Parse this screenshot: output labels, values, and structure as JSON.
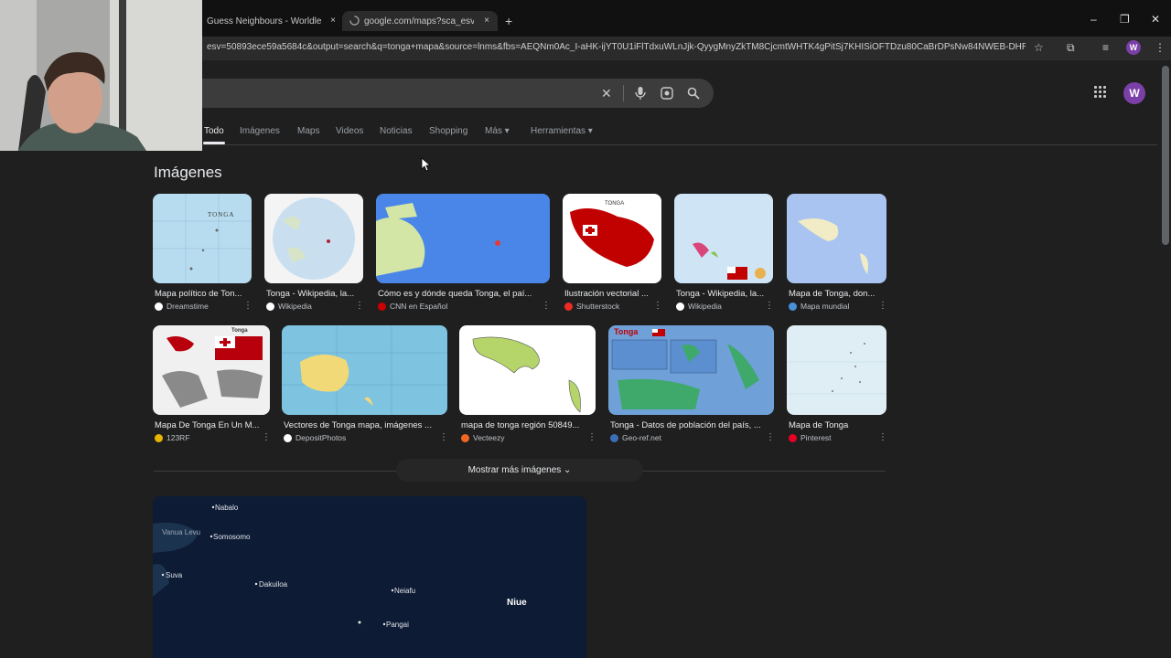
{
  "browser": {
    "tabs": [
      {
        "title": "Guess Neighbours - Worldle",
        "close": "×"
      },
      {
        "title": "google.com/maps?sca_esv=50",
        "close": "×"
      }
    ],
    "new_tab": "+",
    "window_controls": [
      "–",
      "❐",
      "✕"
    ],
    "url": "esv=50893ece59a5684c&output=search&q=tonga+mapa&source=lnms&fbs=AEQNm0Ac_I-aHK-ijYT0U1iFlTdxuWLnJjk-QyygMnyZkTM8CjcmtWHTK4gPitSj7KHISiOFTDzu80CaBrDPsNw84NWEB-DHRUHkN...",
    "avatar_letter": "W"
  },
  "search": {
    "query_fragment": "a",
    "clear": "✕",
    "avatar_letter": "W"
  },
  "nav": {
    "tabs": [
      "Todo",
      "Imágenes",
      "Maps",
      "Videos",
      "Noticias",
      "Shopping",
      "Más ▾",
      "Herramientas ▾"
    ]
  },
  "images_section": {
    "title": "Imágenes",
    "row1": [
      {
        "caption": "Mapa político de Ton...",
        "source": "Dreamstime",
        "fav_color": "#ffffff"
      },
      {
        "caption": "Tonga - Wikipedia, la...",
        "source": "Wikipedia",
        "fav_color": "#ffffff"
      },
      {
        "caption": "Cómo es y dónde queda Tonga, el paí...",
        "source": "CNN en Español",
        "fav_color": "#cc0000"
      },
      {
        "caption": "Ilustración vectorial ...",
        "source": "Shutterstock",
        "fav_color": "#ee2b24"
      },
      {
        "caption": "Tonga - Wikipedia, la...",
        "source": "Wikipedia",
        "fav_color": "#ffffff"
      },
      {
        "caption": "Mapa de Tonga, don...",
        "source": "Mapa mundial",
        "fav_color": "#4a90d9"
      }
    ],
    "row2": [
      {
        "caption": "Mapa De Tonga En Un M...",
        "source": "123RF",
        "fav_color": "#e8b400"
      },
      {
        "caption": "Vectores de Tonga mapa, imágenes ...",
        "source": "DepositPhotos",
        "fav_color": "#ffffff"
      },
      {
        "caption": "mapa de tonga región 50849...",
        "source": "Vecteezy",
        "fav_color": "#f26522"
      },
      {
        "caption": "Tonga - Datos de población del país, ...",
        "source": "Geo-ref.net",
        "fav_color": "#3d6fb6"
      },
      {
        "caption": "Mapa de Tonga",
        "source": "Pinterest",
        "fav_color": "#e60023"
      }
    ],
    "thumb_labels": {
      "tonga_caps": "TONGA",
      "tonga_title": "Tonga"
    },
    "more_button": "Mostrar más imágenes ⌄"
  },
  "map": {
    "places": [
      "Nabalo",
      "Vanua Levu",
      "Somosomo",
      "Suva",
      "Dakuiloa",
      "Neiafu",
      "Pangai"
    ],
    "country_label": "Niue"
  },
  "menu_glyph": "⋮"
}
